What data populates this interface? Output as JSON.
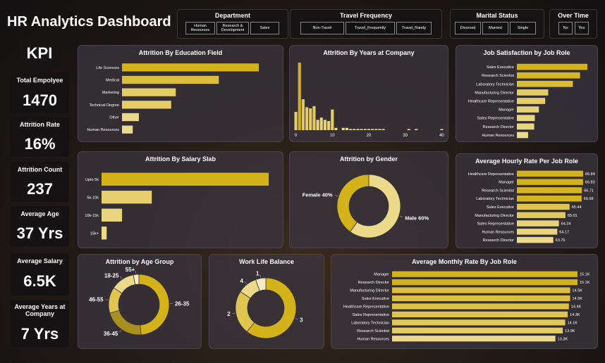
{
  "title": "HR Analytics Dashboard",
  "colors": {
    "gold": "#d4b21a",
    "light": "#ecd98a",
    "mid": "#e0c64f",
    "dark": "#a8901e"
  },
  "slicers": {
    "department": {
      "title": "Department",
      "options": [
        "Human Resources",
        "Research & Development",
        "Sales"
      ]
    },
    "travel": {
      "title": "Travel Frequency",
      "options": [
        "Non-Travel",
        "Travel_Frequently",
        "Travel_Rarely"
      ]
    },
    "marital": {
      "title": "Marital Status",
      "options": [
        "Divorced",
        "Married",
        "Single"
      ]
    },
    "overtime": {
      "title": "Over Time",
      "options": [
        "No",
        "Yes"
      ]
    }
  },
  "kpi": {
    "heading": "KPI",
    "cards": [
      {
        "label": "Total Empolyee",
        "value": "1470"
      },
      {
        "label": "Attrition Rate",
        "value": "16%"
      },
      {
        "label": "Attrition Count",
        "value": "237"
      },
      {
        "label": "Average Age",
        "value": "37 Yrs"
      },
      {
        "label": "Average Salary",
        "value": "6.5K"
      },
      {
        "label": "Average Years at Company",
        "value": "7 Yrs"
      }
    ]
  },
  "chart_data": [
    {
      "id": "education",
      "type": "bar",
      "orientation": "horizontal",
      "title": "Attrition By Education Field",
      "categories": [
        "Life Sciences",
        "Medical",
        "Marketing",
        "Technical Degree",
        "Other",
        "Human Resources"
      ],
      "values": [
        89,
        63,
        35,
        32,
        11,
        7
      ]
    },
    {
      "id": "years",
      "type": "bar",
      "orientation": "vertical",
      "title": "Attrition By Years at Company",
      "x": [
        0,
        1,
        2,
        3,
        4,
        5,
        6,
        7,
        8,
        9,
        10,
        11,
        12,
        13,
        14,
        15,
        16,
        17,
        18,
        19,
        20,
        21,
        22,
        23,
        24,
        25,
        26,
        27,
        28,
        29,
        30,
        31,
        32,
        33,
        34,
        35,
        36,
        37,
        38,
        39,
        40
      ],
      "values": [
        16,
        59,
        27,
        20,
        19,
        21,
        9,
        11,
        9,
        8,
        18,
        2,
        0,
        2,
        2,
        1,
        1,
        1,
        1,
        1,
        1,
        1,
        1,
        1,
        1,
        0,
        0,
        0,
        0,
        0,
        0,
        1,
        0,
        1,
        0,
        0,
        0,
        0,
        0,
        0,
        1
      ],
      "xticks": [
        0,
        10,
        20,
        30,
        40
      ],
      "xlim": [
        0,
        40
      ]
    },
    {
      "id": "jobsat",
      "type": "bar",
      "orientation": "horizontal",
      "title": "Job Satisfaction by Job Role",
      "categories": [
        "Sales Executive",
        "Research Scientist",
        "Laboratory Technician",
        "Manufacturing Director",
        "Healthcare Representative",
        "Manager",
        "Sales Representative",
        "Research Director",
        "Human Resources"
      ],
      "values": [
        326,
        292,
        259,
        145,
        131,
        102,
        83,
        80,
        52
      ]
    },
    {
      "id": "salary",
      "type": "bar",
      "orientation": "horizontal",
      "title": "Attrition By Salary Slab",
      "categories": [
        "Upto 5k",
        "5k-10k",
        "10k-15k",
        "15k+"
      ],
      "values": [
        163,
        49,
        20,
        5
      ]
    },
    {
      "id": "gender",
      "type": "pie",
      "donut": true,
      "title": "Attrition by Gender",
      "categories": [
        "Male",
        "Female"
      ],
      "values": [
        60,
        40
      ],
      "labels": [
        "Male 60%",
        "Female 40%"
      ]
    },
    {
      "id": "hourly",
      "type": "bar",
      "orientation": "horizontal",
      "title": "Average Hourly Rate Per Job Role",
      "categories": [
        "Healthcare Representative",
        "Manager",
        "Research Scientist",
        "Laboratory Technician",
        "Sales Executive",
        "Manufacturing Director",
        "Sales Representative",
        "Human Resources",
        "Research Director"
      ],
      "values": [
        66.84,
        66.83,
        66.71,
        66.68,
        65.44,
        65.01,
        64.34,
        64.17,
        63.76
      ],
      "data_labels": [
        "66.84",
        "66.83",
        "66.71",
        "66.68",
        "65.44",
        "65.01",
        "64.34",
        "64.17",
        "63.76"
      ]
    },
    {
      "id": "agegroup",
      "type": "pie",
      "donut": true,
      "title": "Attrition by Age Group",
      "categories": [
        "26-35",
        "36-45",
        "46-55",
        "18-25",
        "55+"
      ],
      "values": [
        116,
        51,
        33,
        30,
        7
      ]
    },
    {
      "id": "wlb",
      "type": "pie",
      "donut": true,
      "title": "Work Life Balance",
      "categories": [
        "3",
        "2",
        "4",
        "1"
      ],
      "values": [
        893,
        344,
        153,
        80
      ]
    },
    {
      "id": "monthly",
      "type": "bar",
      "orientation": "horizontal",
      "title": "Average Monthly Rate By Job Role",
      "categories": [
        "Manager",
        "Research Director",
        "Manufacturing Director",
        "Sales Executive",
        "Healthcare Representative",
        "Sales Representative",
        "Laboratory Technician",
        "Research Scientist",
        "Human Resources"
      ],
      "values": [
        15.1,
        15.1,
        14.5,
        14.5,
        14.4,
        14.3,
        14.1,
        13.9,
        13.3
      ],
      "data_labels": [
        "15.1K",
        "15.1K",
        "14.5K",
        "14.5K",
        "14.4K",
        "14.3K",
        "14.1K",
        "13.9K",
        "13.3K"
      ]
    }
  ]
}
